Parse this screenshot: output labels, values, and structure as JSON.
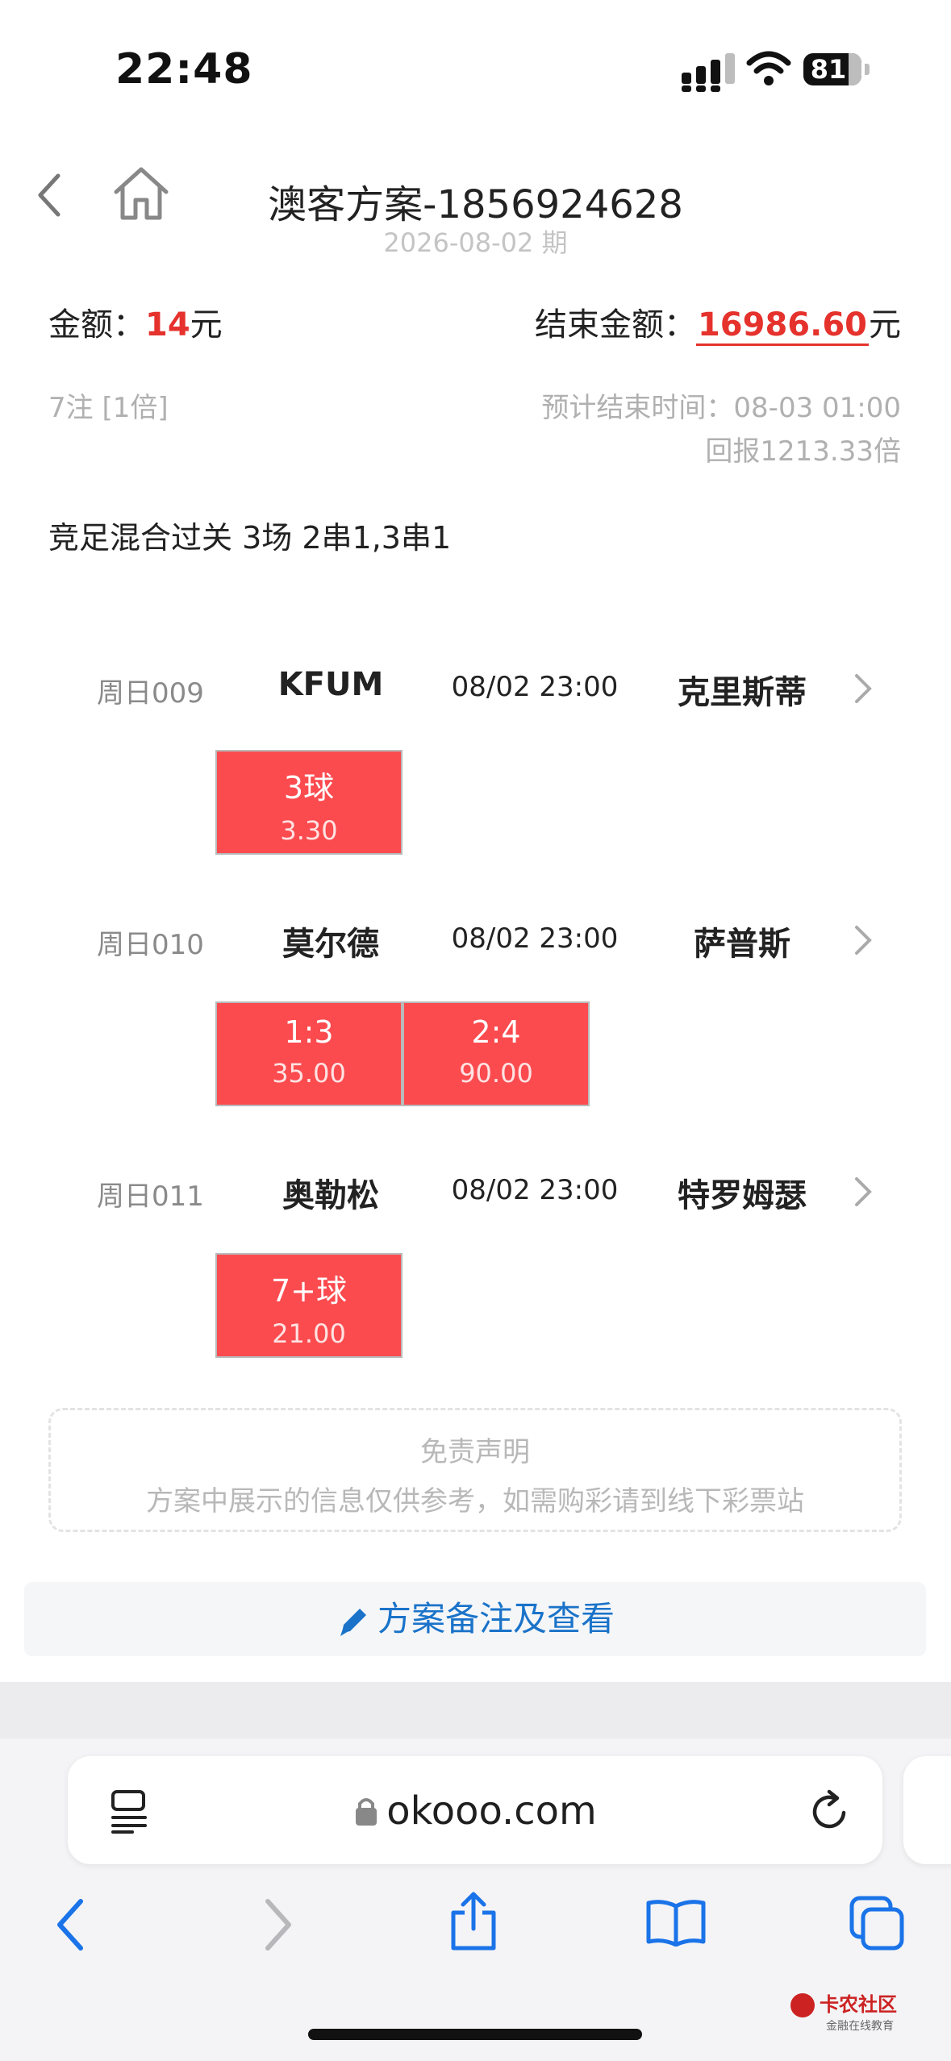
{
  "status_bar": {
    "time": "22:48",
    "battery": "81"
  },
  "header": {
    "title": "澳客方案-1856924628",
    "subtitle": "2026-08-02 期"
  },
  "summary": {
    "amount_label": "金额：",
    "amount_value": "14",
    "amount_unit": "元",
    "end_amount_label": "结束金额：",
    "end_amount_value": "16986.60",
    "end_amount_unit": "元",
    "bets_info": "7注 [1倍]",
    "end_time": "预计结束时间：08-03 01:00",
    "return_rate": "回报1213.33倍"
  },
  "play_type": "竞足混合过关 3场 2串1,3串1",
  "matches": [
    {
      "weekday": "周日009",
      "home": "KFUM",
      "time": "08/02 23:00",
      "away": "克里斯蒂",
      "picks": [
        {
          "label": "3球",
          "odds": "3.30"
        }
      ]
    },
    {
      "weekday": "周日010",
      "home": "莫尔德",
      "time": "08/02 23:00",
      "away": "萨普斯",
      "picks": [
        {
          "label": "1:3",
          "odds": "35.00"
        },
        {
          "label": "2:4",
          "odds": "90.00"
        }
      ]
    },
    {
      "weekday": "周日011",
      "home": "奥勒松",
      "time": "08/02 23:00",
      "away": "特罗姆瑟",
      "picks": [
        {
          "label": "7+球",
          "odds": "21.00"
        }
      ]
    }
  ],
  "disclaimer": {
    "title": "免责声明",
    "body": "方案中展示的信息仅供参考，如需购彩请到线下彩票站"
  },
  "notes_button": "方案备注及查看",
  "browser": {
    "url": "okooo.com"
  },
  "watermark": {
    "name": "卡农社区",
    "tagline": "金融在线教育"
  },
  "colors": {
    "accent_red": "#e5322d",
    "pick_red": "#fb4b4f",
    "link_blue": "#1a73c9",
    "browser_blue": "#1a73e8"
  }
}
